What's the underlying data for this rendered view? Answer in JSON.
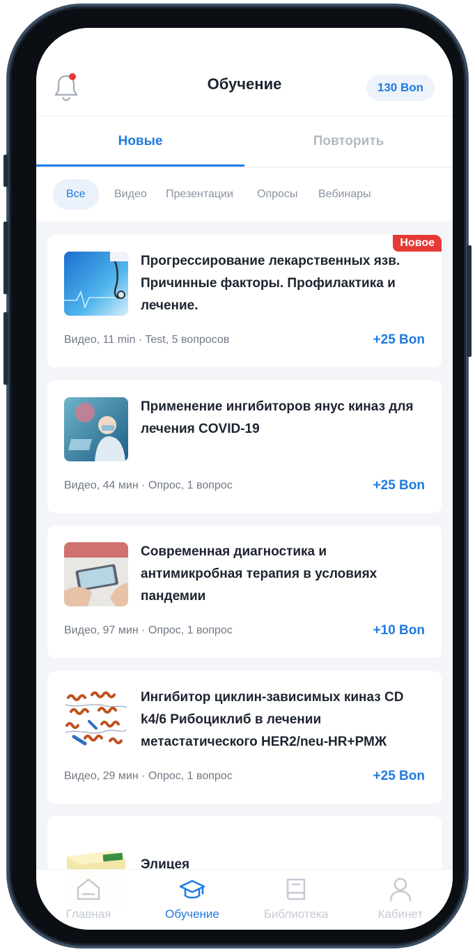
{
  "header": {
    "title": "Обучение",
    "balance": "130 Bon",
    "notification_icon": "bell-icon"
  },
  "tabs": [
    {
      "label": "Новые",
      "active": true
    },
    {
      "label": "Повторить",
      "active": false
    }
  ],
  "filters": [
    {
      "label": "Все",
      "active": true
    },
    {
      "label": "Видео",
      "active": false
    },
    {
      "label": "Презентации",
      "active": false
    },
    {
      "label": "Опросы",
      "active": false
    },
    {
      "label": "Вебинары",
      "active": false
    }
  ],
  "cards": [
    {
      "title": "Прогрессирование лекарственных язв. Причинные факторы. Профилактика и лечение.",
      "meta": "Видео, 11 min · Test, 5 вопросов",
      "points": "+25 Bon",
      "badge": "Новое"
    },
    {
      "title": "Применение ингибиторов янус киназ для лечения COVID-19",
      "meta": "Видео, 44 мин · Опрос, 1 вопрос",
      "points": "+25 Bon"
    },
    {
      "title": "Современная диагностика и антимикробная терапия в условиях пандемии",
      "meta": "Видео, 97 мин · Опрос, 1 вопрос",
      "points": "+10 Bon"
    },
    {
      "title": "Ингибитор циклин-зависимых киназ CD k4/6 Рибоциклиб в лечении метастатического HER2/neu-HR+РМЖ",
      "meta": "Видео, 29 мин · Опрос, 1 вопрос",
      "points": "+25 Bon"
    },
    {
      "title": "Элицея"
    }
  ],
  "bottom_nav": [
    {
      "label": "Главная",
      "icon": "home-icon",
      "active": false
    },
    {
      "label": "Обучение",
      "icon": "graduation-cap-icon",
      "active": true
    },
    {
      "label": "Библиотека",
      "icon": "book-icon",
      "active": false
    },
    {
      "label": "Кабинет",
      "icon": "user-icon",
      "active": false
    }
  ],
  "colors": {
    "accent": "#1e7be0",
    "badge": "#e53935",
    "background": "#f3f5f8"
  }
}
